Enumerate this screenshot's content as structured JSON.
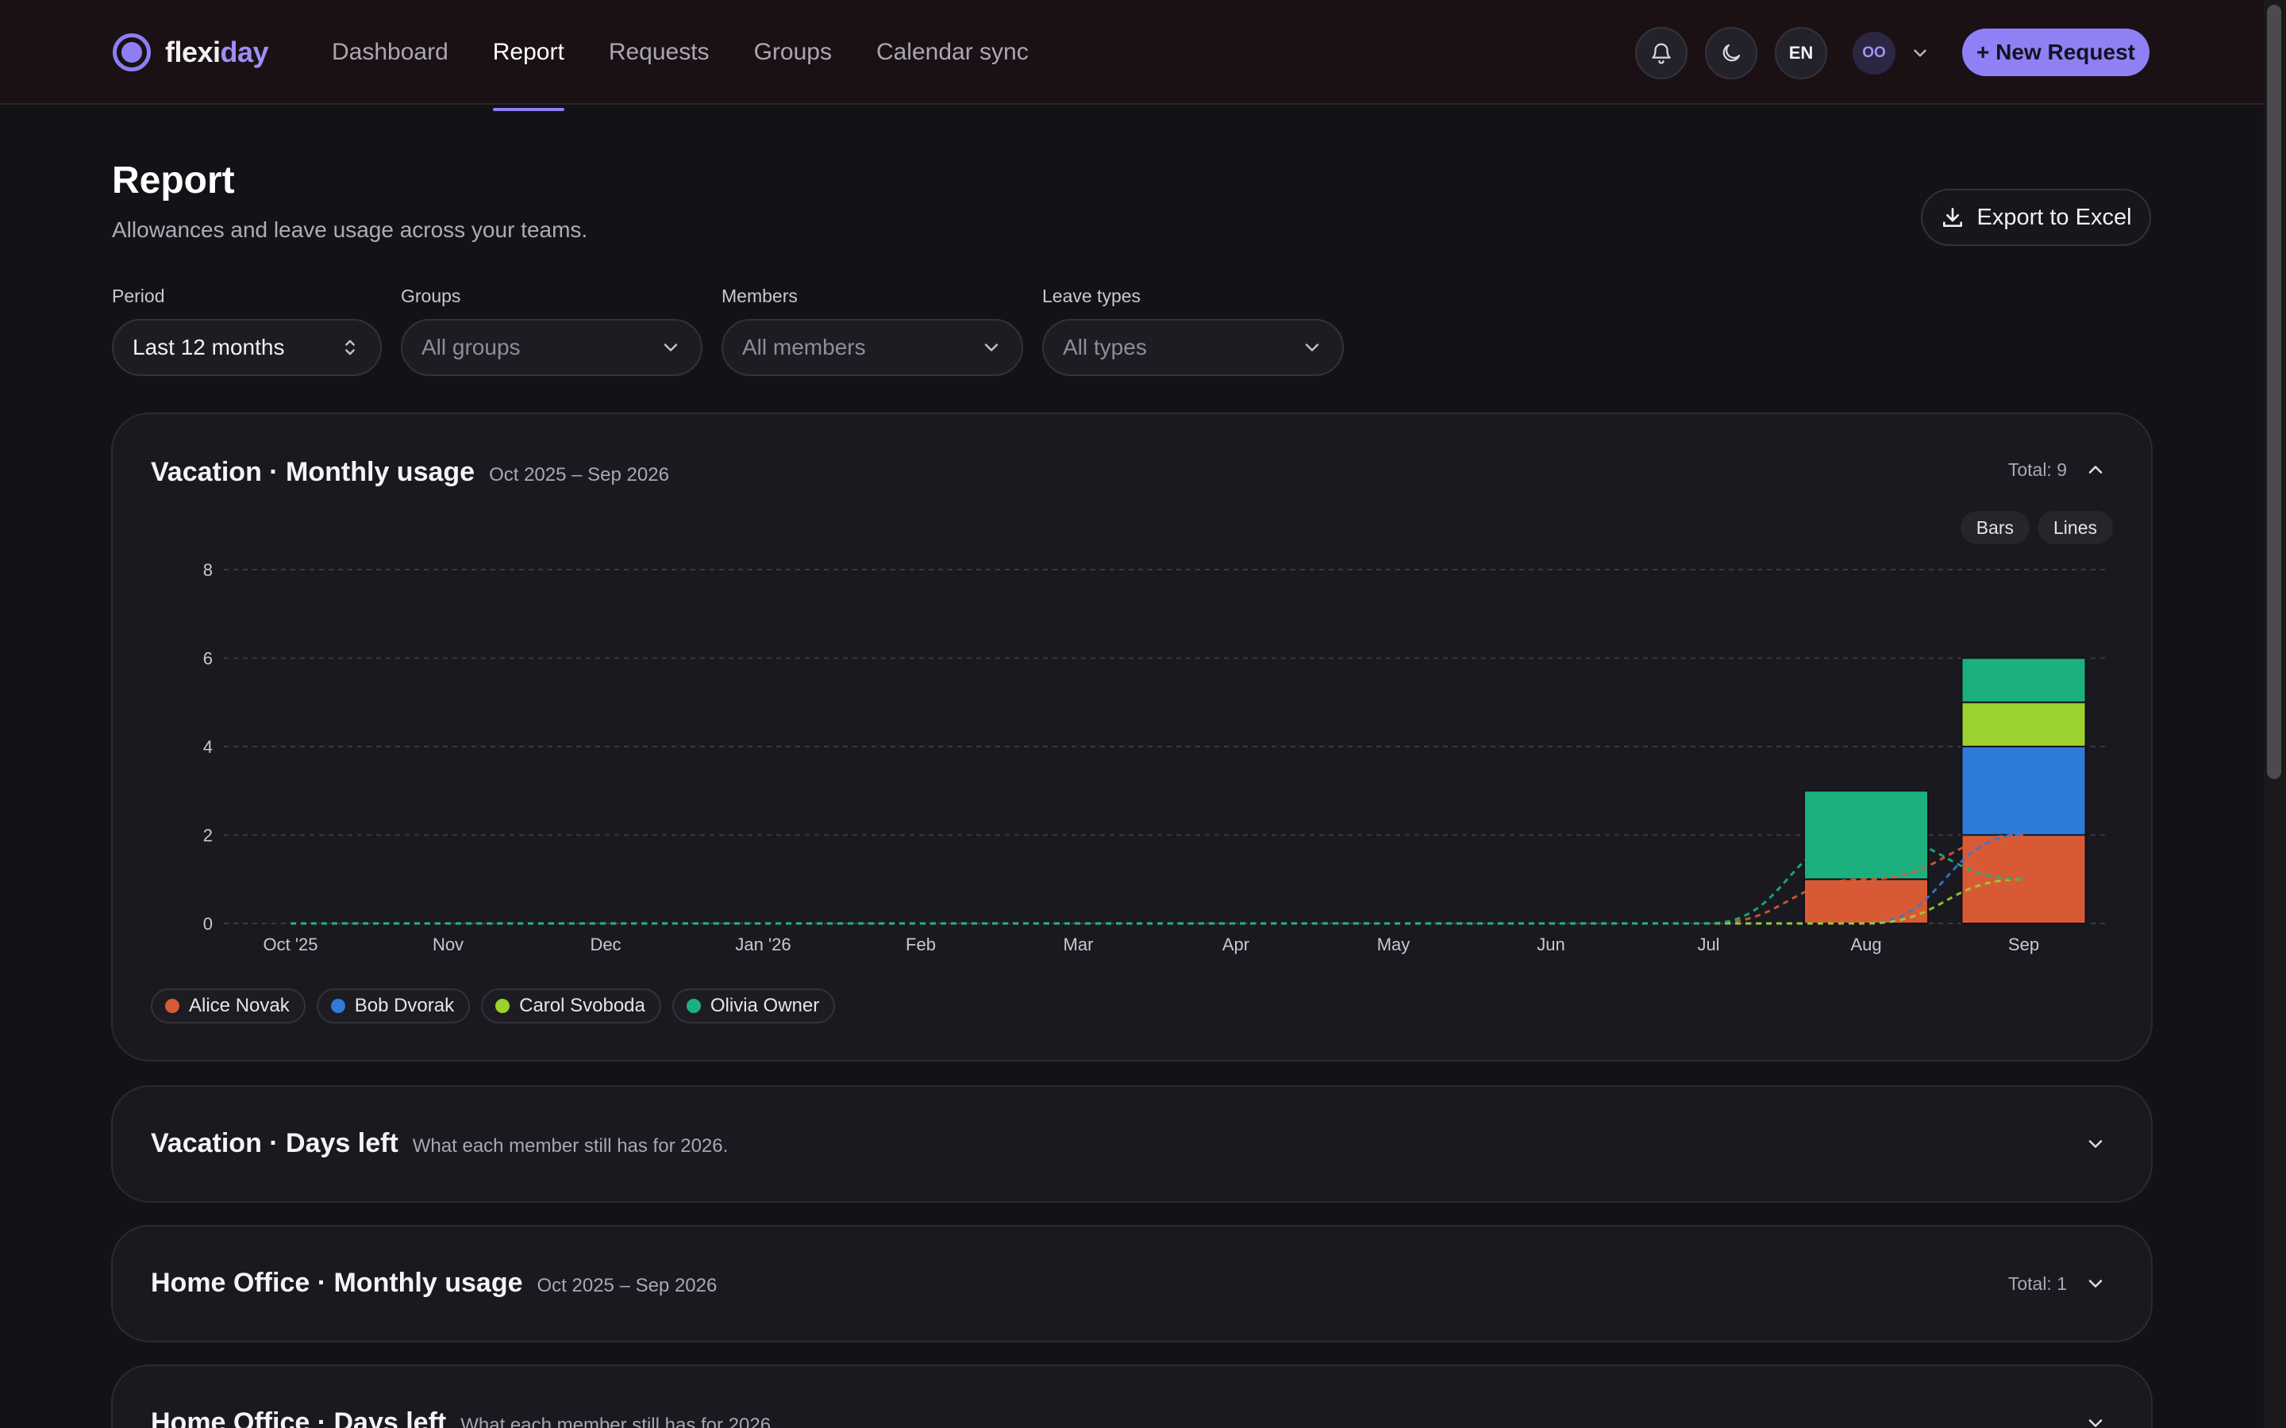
{
  "brand": {
    "name_a": "flexi",
    "name_b": "day",
    "accent": "#8d7ef5"
  },
  "nav": [
    {
      "label": "Dashboard",
      "active": false
    },
    {
      "label": "Report",
      "active": true
    },
    {
      "label": "Requests",
      "active": false
    },
    {
      "label": "Groups",
      "active": false
    },
    {
      "label": "Calendar sync",
      "active": false
    }
  ],
  "header": {
    "notifications_icon": "bell-icon",
    "theme_icon": "moon-icon",
    "language": "EN",
    "avatar_initials": "OO",
    "new_request_label": "+ New Request"
  },
  "page": {
    "title": "Report",
    "subtitle": "Allowances and leave usage across your teams.",
    "export_label": "Export to Excel"
  },
  "filters": {
    "period": {
      "label": "Period",
      "value": "Last 12 months"
    },
    "groups": {
      "label": "Groups",
      "value": "All groups"
    },
    "members": {
      "label": "Members",
      "value": "All members"
    },
    "leave_types": {
      "label": "Leave types",
      "value": "All types"
    }
  },
  "cards": {
    "vacation_usage": {
      "title": "Vacation · Monthly usage",
      "subtitle": "Oct 2025 – Sep 2026",
      "total": "Total: 9",
      "expanded": true,
      "toggle": [
        "Bars",
        "Lines"
      ]
    },
    "vacation_left": {
      "title": "Vacation · Days left",
      "subtitle": "What each member still has for 2026."
    },
    "home_usage": {
      "title": "Home Office · Monthly usage",
      "subtitle": "Oct 2025 – Sep 2026",
      "total": "Total: 1"
    },
    "home_left": {
      "title": "Home Office · Days left",
      "subtitle": "What each member still has for 2026."
    }
  },
  "chart_data": {
    "type": "bar",
    "stacked": true,
    "categories": [
      "Oct '25",
      "Nov",
      "Dec",
      "Jan '26",
      "Feb",
      "Mar",
      "Apr",
      "May",
      "Jun",
      "Jul",
      "Aug",
      "Sep"
    ],
    "ylim": [
      0,
      8
    ],
    "yticks": [
      0,
      2,
      4,
      6,
      8
    ],
    "grid": true,
    "legend_position": "bottom-left",
    "series": [
      {
        "name": "Alice Novak",
        "color": "#d85a35",
        "values": [
          0,
          0,
          0,
          0,
          0,
          0,
          0,
          0,
          0,
          0,
          1,
          2
        ]
      },
      {
        "name": "Bob Dvorak",
        "color": "#2f7bd8",
        "values": [
          0,
          0,
          0,
          0,
          0,
          0,
          0,
          0,
          0,
          0,
          0,
          2
        ]
      },
      {
        "name": "Carol Svoboda",
        "color": "#9bd22d",
        "values": [
          0,
          0,
          0,
          0,
          0,
          0,
          0,
          0,
          0,
          0,
          0,
          1
        ]
      },
      {
        "name": "Olivia Owner",
        "color": "#1db07f",
        "values": [
          0,
          0,
          0,
          0,
          0,
          0,
          0,
          0,
          0,
          0,
          2,
          1
        ]
      }
    ]
  }
}
